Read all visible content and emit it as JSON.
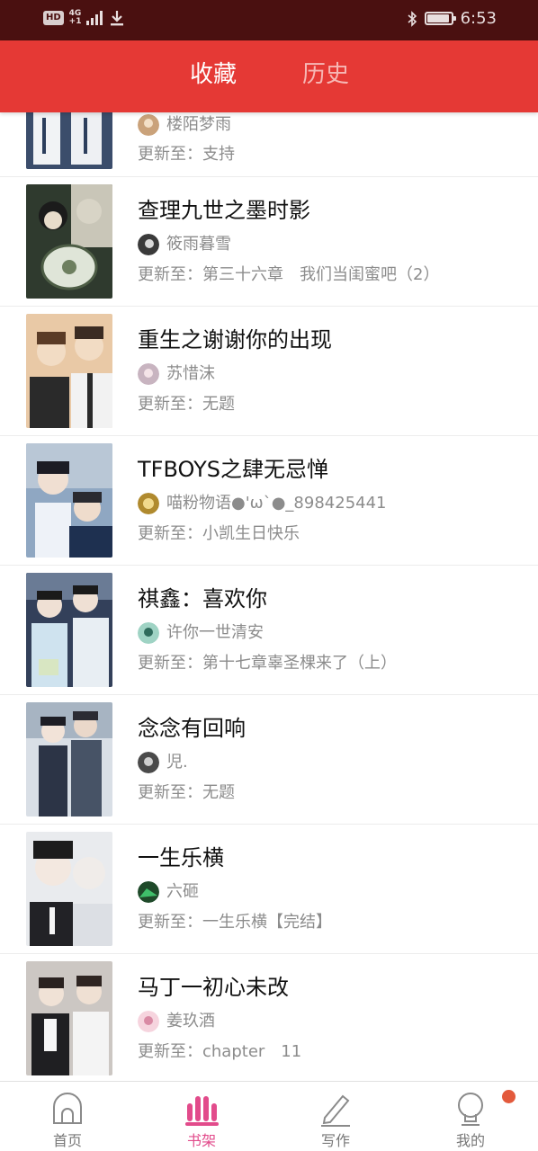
{
  "status_bar": {
    "hd": "HD",
    "net_top": "4G",
    "net_bottom": "+1",
    "time": "6:53",
    "battery_level": 0.95,
    "icons": [
      "hd-icon",
      "signal-icon",
      "download-icon",
      "bluetooth-icon",
      "battery-icon"
    ]
  },
  "header": {
    "tabs": [
      {
        "label": "收藏",
        "active": true
      },
      {
        "label": "历史",
        "active": false
      }
    ],
    "colors": {
      "bar": "#e53935",
      "active": "#ffffff",
      "inactive": "#f6b7b4"
    }
  },
  "books": [
    {
      "title": "",
      "author": "楼陌梦雨",
      "update": "更新至：支持"
    },
    {
      "title": "查理九世之墨时影",
      "author": "筱雨暮雪",
      "update": "更新至：第三十六章　我们当闺蜜吧（2）"
    },
    {
      "title": "重生之谢谢你的出现",
      "author": "苏惜沫",
      "update": "更新至：无题"
    },
    {
      "title": "TFBOYS之肆无忌惮",
      "author": "喵粉物语●'ω`●_898425441",
      "update": "更新至：小凯生日快乐"
    },
    {
      "title": "祺鑫：喜欢你",
      "author": "许你一世清安",
      "update": "更新至：第十七章辜圣棵来了（上）"
    },
    {
      "title": "念念有回响",
      "author": "児.",
      "update": "更新至：无题"
    },
    {
      "title": "一生乐横",
      "author": "六砸",
      "update": "更新至：一生乐横【完结】"
    },
    {
      "title": "马丁一初心未改",
      "author": "姜玖酒",
      "update": "更新至：chapter　11"
    }
  ],
  "bottom_nav": [
    {
      "label": "首页",
      "icon": "home-icon",
      "active": false
    },
    {
      "label": "书架",
      "icon": "bookshelf-icon",
      "active": true
    },
    {
      "label": "写作",
      "icon": "pen-icon",
      "active": false
    },
    {
      "label": "我的",
      "icon": "profile-icon",
      "active": false,
      "badge": true
    }
  ],
  "colors": {
    "accent": "#e53935",
    "nav_active": "#e24b8b",
    "badge": "#e35a3c",
    "status_bar": "#4a1010"
  }
}
